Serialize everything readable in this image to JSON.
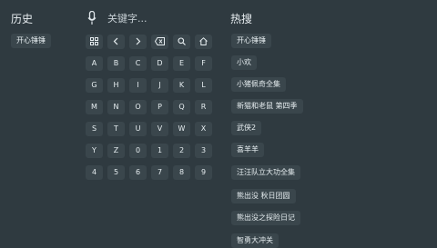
{
  "history": {
    "title": "历史",
    "items": [
      "开心锤锤"
    ]
  },
  "search": {
    "placeholder": "关键字..."
  },
  "keyboard": {
    "function_keys": [
      "grid-icon",
      "chevron-left-icon",
      "chevron-right-icon",
      "backspace-icon",
      "search-icon",
      "home-icon"
    ],
    "rows": [
      [
        "A",
        "B",
        "C",
        "D",
        "E",
        "F"
      ],
      [
        "G",
        "H",
        "I",
        "J",
        "K",
        "L"
      ],
      [
        "M",
        "N",
        "O",
        "P",
        "Q",
        "R"
      ],
      [
        "S",
        "T",
        "U",
        "V",
        "W",
        "X"
      ],
      [
        "Y",
        "Z",
        "0",
        "1",
        "2",
        "3"
      ],
      [
        "4",
        "5",
        "6",
        "7",
        "8",
        "9"
      ]
    ]
  },
  "hot": {
    "title": "热搜",
    "items": [
      "开心锤锤",
      "小欢",
      "小猪佩奇全集",
      "新猫和老鼠 第四季",
      "武侠2",
      "喜羊羊",
      "汪汪队立大功全集",
      "熊出没 秋日团圆",
      "熊出没之探险日记",
      "智勇大冲关"
    ]
  }
}
